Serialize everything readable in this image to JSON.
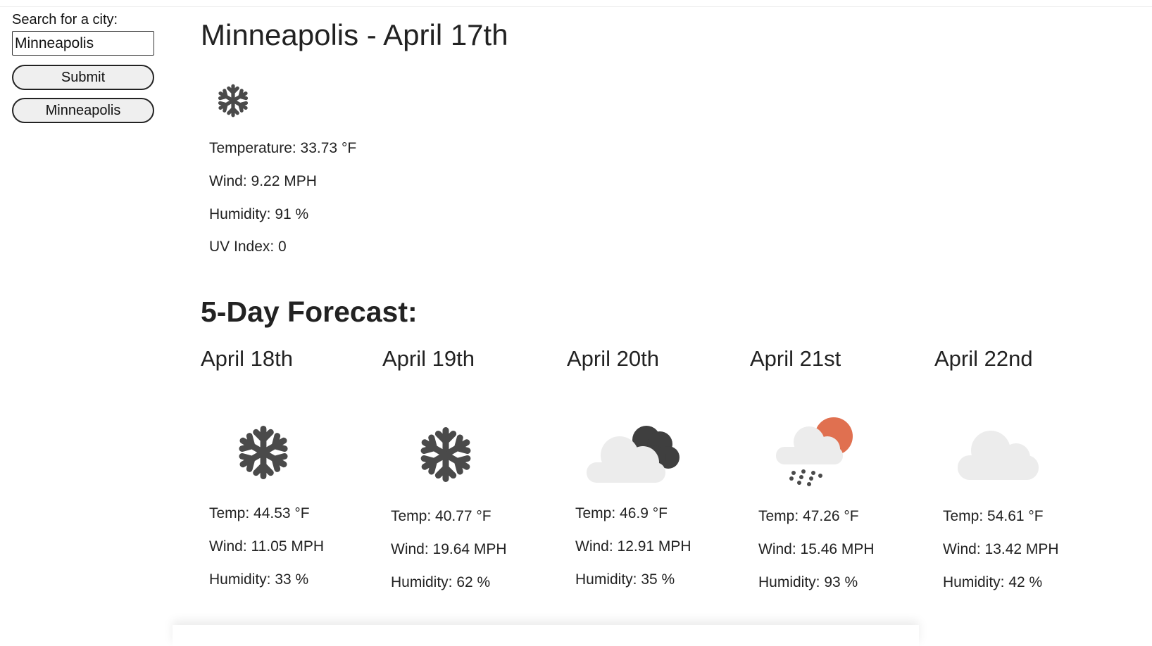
{
  "sidebar": {
    "search_label": "Search for a city:",
    "search_value": "Minneapolis",
    "submit_label": "Submit",
    "history": [
      "Minneapolis"
    ]
  },
  "current": {
    "title": "Minneapolis - April 17th",
    "icon": "snowflake-icon",
    "temperature": "Temperature: 33.73 °F",
    "wind": "Wind: 9.22 MPH",
    "humidity": "Humidity: 91 %",
    "uv_index": "UV Index: 0"
  },
  "forecast": {
    "title": "5-Day Forecast:",
    "days": [
      {
        "date": "April 18th",
        "icon": "snowflake-icon",
        "temp": "Temp: 44.53 °F",
        "wind": "Wind: 11.05 MPH",
        "humidity": "Humidity: 33 %"
      },
      {
        "date": "April 19th",
        "icon": "snowflake-icon",
        "temp": "Temp: 40.77 °F",
        "wind": "Wind: 19.64 MPH",
        "humidity": "Humidity: 62 %"
      },
      {
        "date": "April 20th",
        "icon": "cloudy-night-icon",
        "temp": "Temp: 46.9 °F",
        "wind": "Wind: 12.91 MPH",
        "humidity": "Humidity: 35 %"
      },
      {
        "date": "April 21st",
        "icon": "rain-sun-icon",
        "temp": "Temp: 47.26 °F",
        "wind": "Wind: 15.46 MPH",
        "humidity": "Humidity: 93 %"
      },
      {
        "date": "April 22nd",
        "icon": "cloud-icon",
        "temp": "Temp: 54.61 °F",
        "wind": "Wind: 13.42 MPH",
        "humidity": "Humidity: 42 %"
      }
    ]
  },
  "colors": {
    "text": "#222222",
    "icon_dark": "#4a4a4a",
    "cloud_light": "#ececec",
    "sun": "#e07050",
    "button_bg": "#efefef"
  }
}
